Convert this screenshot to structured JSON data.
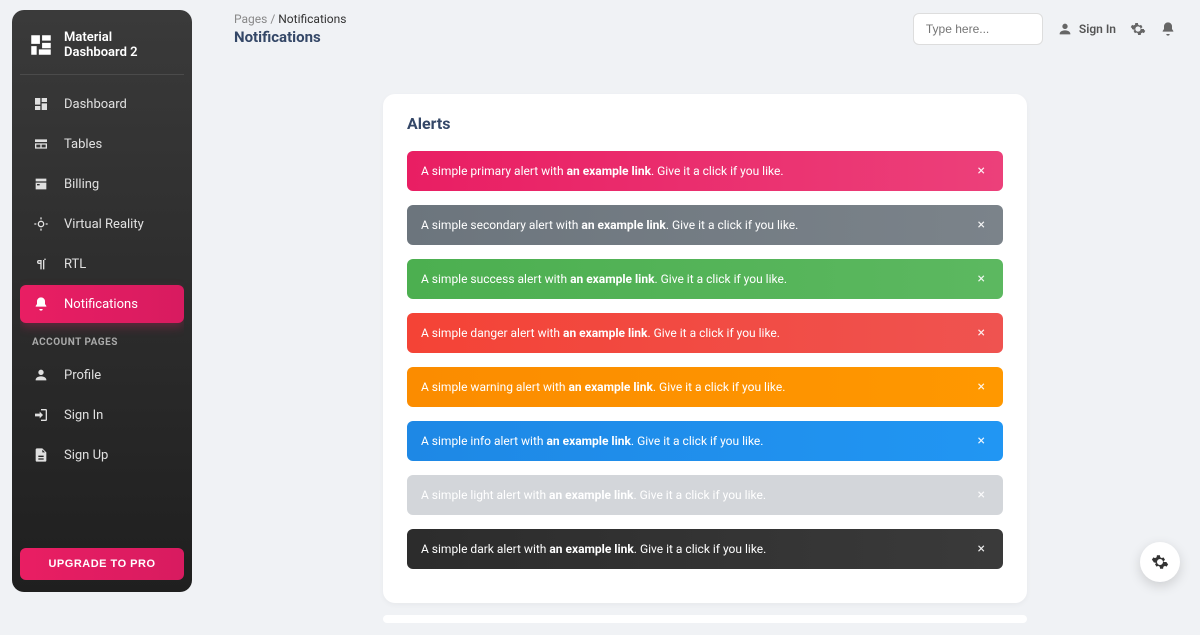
{
  "brand": {
    "title": "Material Dashboard 2"
  },
  "sidebar": {
    "items": [
      {
        "label": "Dashboard"
      },
      {
        "label": "Tables"
      },
      {
        "label": "Billing"
      },
      {
        "label": "Virtual Reality"
      },
      {
        "label": "RTL"
      },
      {
        "label": "Notifications"
      }
    ],
    "section": "ACCOUNT PAGES",
    "account_items": [
      {
        "label": "Profile"
      },
      {
        "label": "Sign In"
      },
      {
        "label": "Sign Up"
      }
    ],
    "upgrade": "UPGRADE TO PRO"
  },
  "breadcrumb": {
    "root": "Pages",
    "sep": "/",
    "current": "Notifications"
  },
  "page_title": "Notifications",
  "search": {
    "placeholder": "Type here..."
  },
  "topbar": {
    "signin": "Sign In"
  },
  "card": {
    "title": "Alerts"
  },
  "alerts": [
    {
      "variant": "primary",
      "pre": "A simple primary alert with ",
      "link": "an example link",
      "post": ". Give it a click if you like."
    },
    {
      "variant": "secondary",
      "pre": "A simple secondary alert with ",
      "link": "an example link",
      "post": ". Give it a click if you like."
    },
    {
      "variant": "success",
      "pre": "A simple success alert with ",
      "link": "an example link",
      "post": ". Give it a click if you like."
    },
    {
      "variant": "danger",
      "pre": "A simple danger alert with ",
      "link": "an example link",
      "post": ". Give it a click if you like."
    },
    {
      "variant": "warning",
      "pre": "A simple warning alert with ",
      "link": "an example link",
      "post": ". Give it a click if you like."
    },
    {
      "variant": "info",
      "pre": "A simple info alert with ",
      "link": "an example link",
      "post": ". Give it a click if you like."
    },
    {
      "variant": "light",
      "pre": "A simple light alert with ",
      "link": "an example link",
      "post": ". Give it a click if you like."
    },
    {
      "variant": "dark",
      "pre": "A simple dark alert with ",
      "link": "an example link",
      "post": ". Give it a click if you like."
    }
  ]
}
